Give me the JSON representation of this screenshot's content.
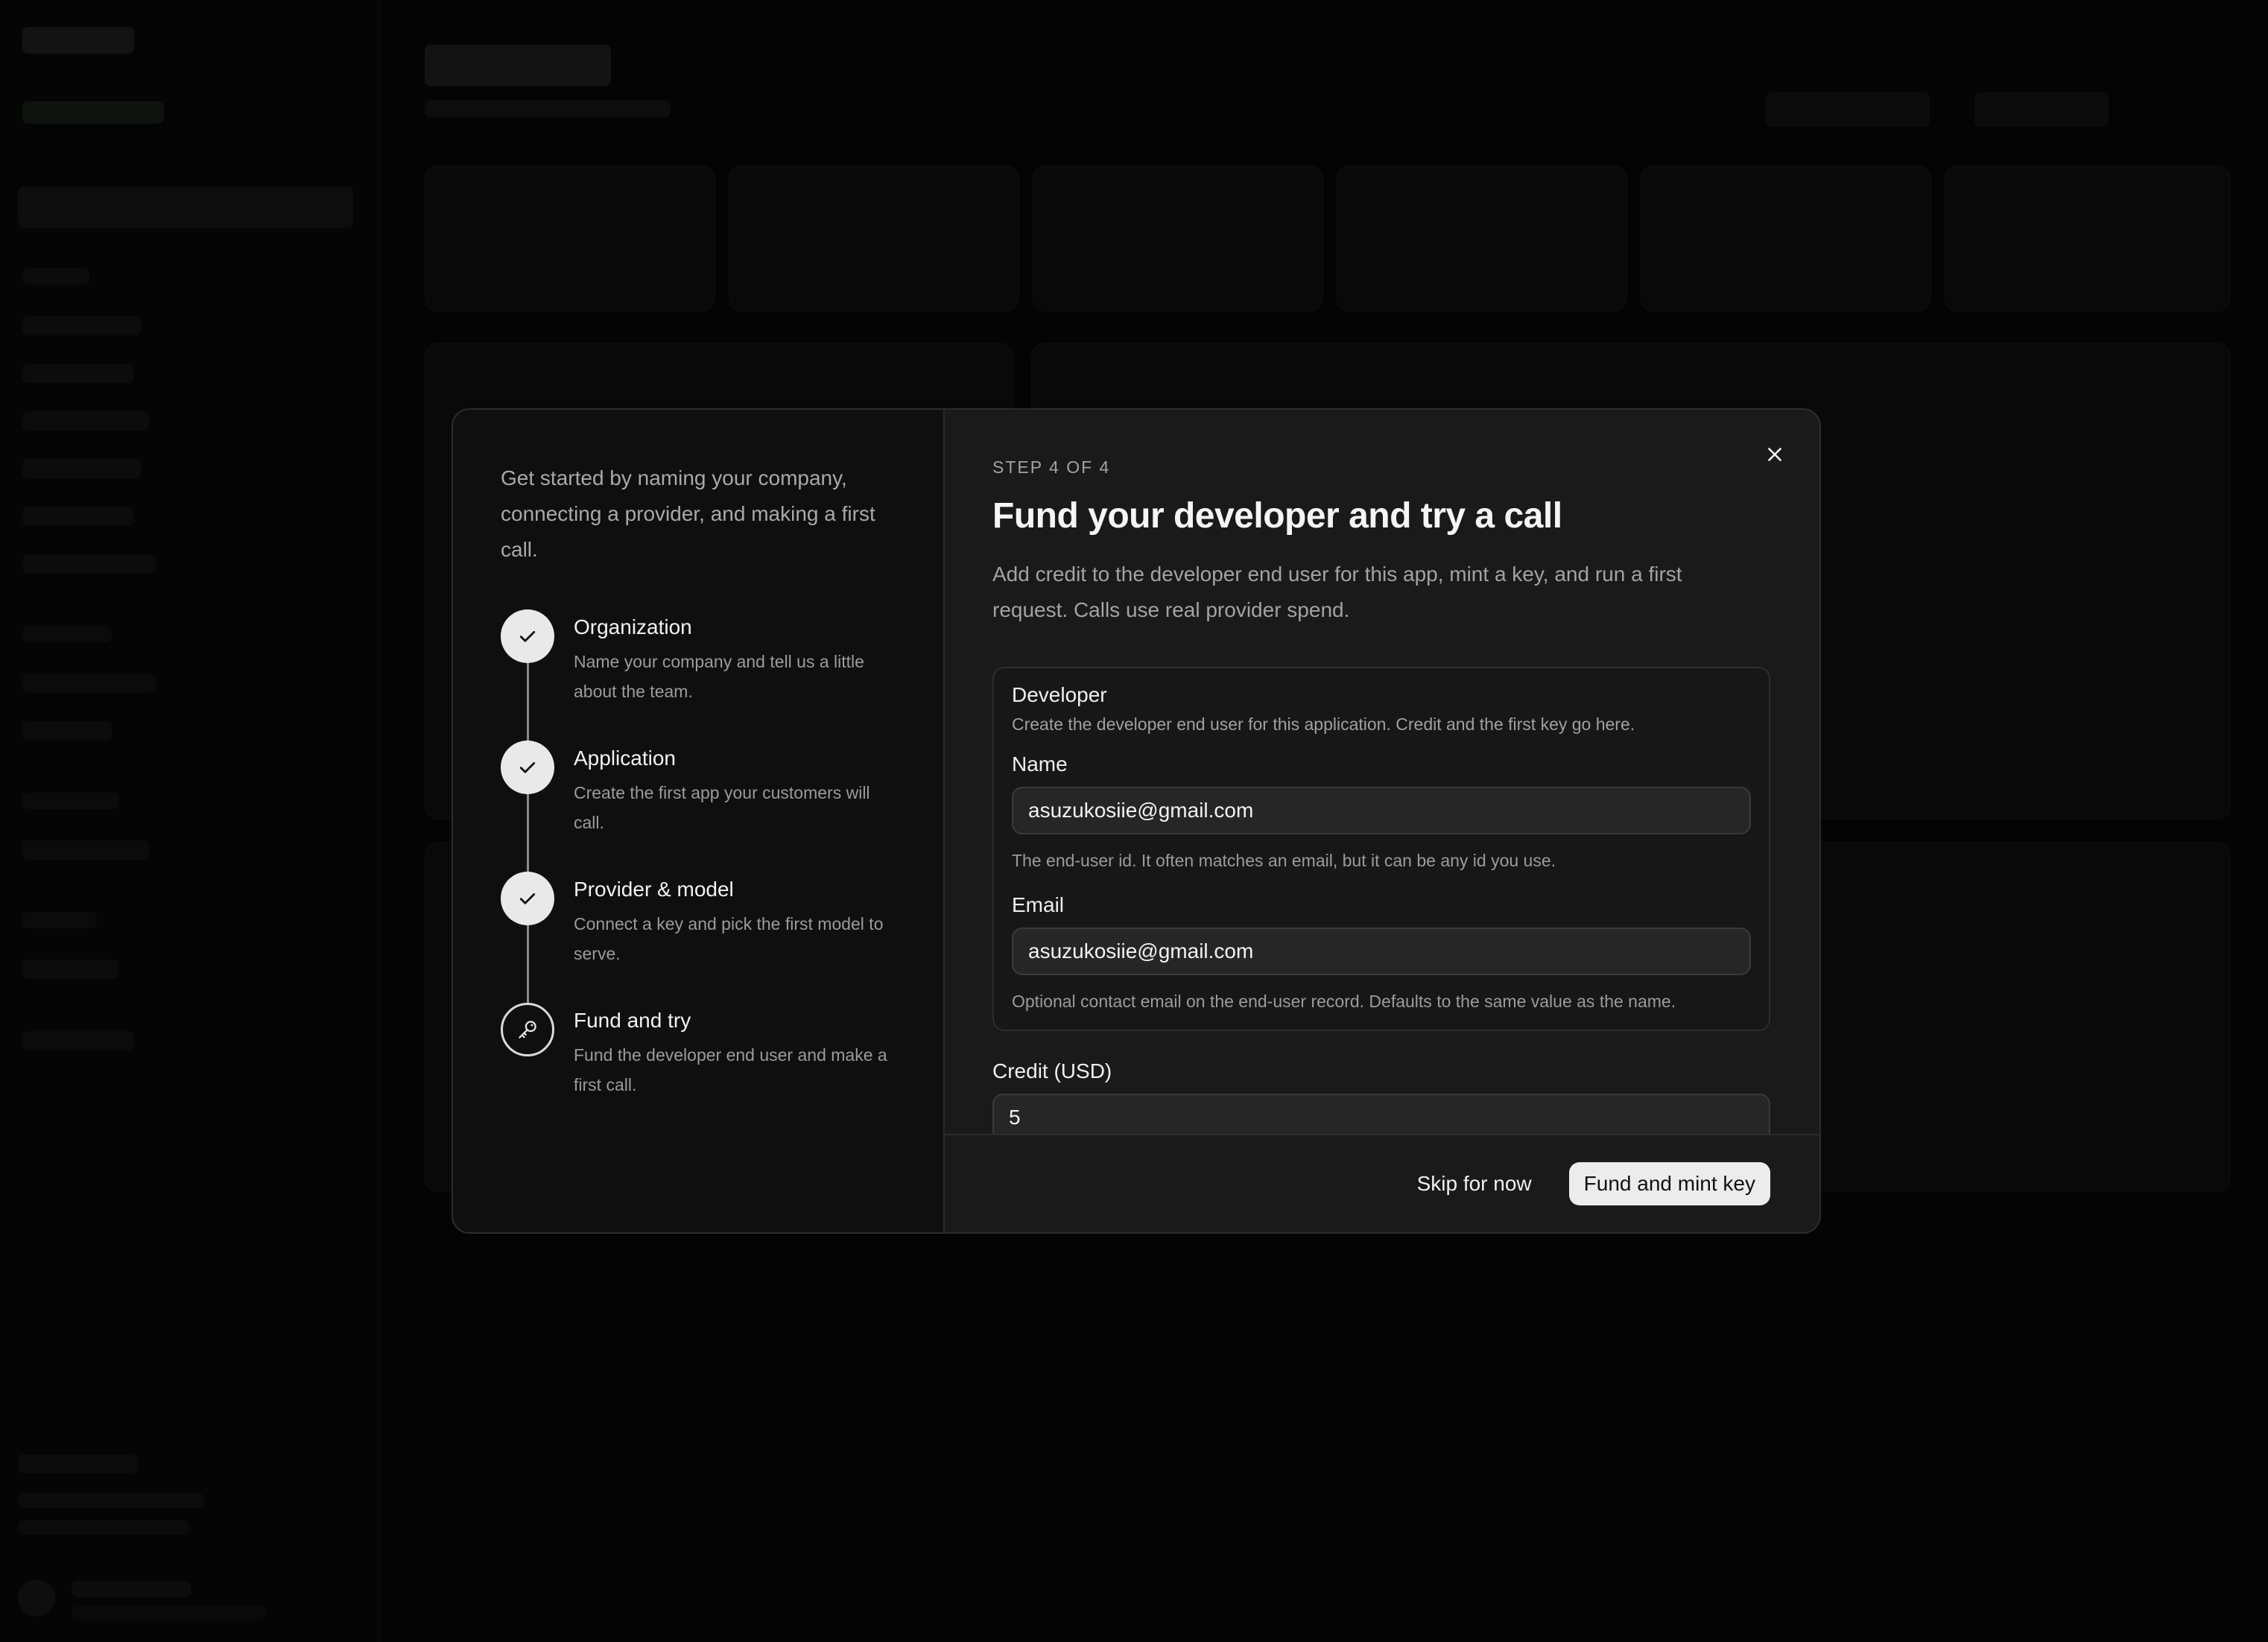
{
  "onboarding": {
    "intro": "Get started by naming your company, connecting a provider, and making a first call.",
    "steps": [
      {
        "title": "Organization",
        "desc": "Name your company and tell us a little about the team.",
        "state": "complete"
      },
      {
        "title": "Application",
        "desc": "Create the first app your customers will call.",
        "state": "complete"
      },
      {
        "title": "Provider & model",
        "desc": "Connect a key and pick the first model to serve.",
        "state": "complete"
      },
      {
        "title": "Fund and try",
        "desc": "Fund the developer end user and make a first call.",
        "state": "current",
        "icon": "key-icon"
      }
    ]
  },
  "content": {
    "step_label": "STEP 4 OF 4",
    "title": "Fund your developer and try a call",
    "description": "Add credit to the developer end user for this app, mint a key, and run a first request. Calls use real provider spend.",
    "developer": {
      "title": "Developer",
      "description": "Create the developer end user for this application. Credit and the first key go here.",
      "name_label": "Name",
      "name_value": "asuzukosiie@gmail.com",
      "name_hint": "The end-user id. It often matches an email, but it can be any id you use.",
      "email_label": "Email",
      "email_value": "asuzukosiie@gmail.com",
      "email_hint": "Optional contact email on the end-user record. Defaults to the same value as the name."
    },
    "credit_label": "Credit (USD)",
    "credit_value": "5"
  },
  "footer": {
    "skip_label": "Skip for now",
    "primary_label": "Fund and mint key"
  },
  "colors": {
    "accent": "#ececec",
    "modal_bg": "#1a1a1a",
    "panel_bg": "#0f0f0f"
  }
}
